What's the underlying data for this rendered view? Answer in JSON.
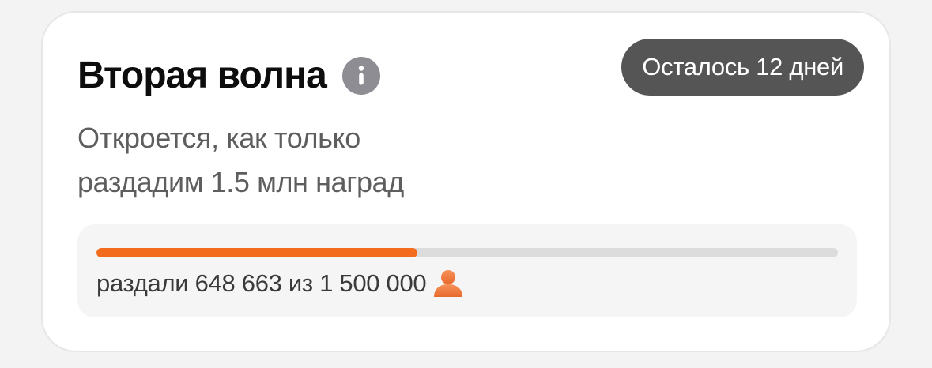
{
  "card": {
    "title": "Вторая волна",
    "badge": "Осталось 12 дней",
    "subtitle_line1": "Откроется, как только",
    "subtitle_line2": "раздадим 1.5 млн наград"
  },
  "progress": {
    "label": "раздали 648 663 из 1 500 000",
    "value": 648663,
    "max": 1500000,
    "fraction": 0.4324
  },
  "icons": {
    "info": "info-icon",
    "person": "person-icon"
  },
  "colors": {
    "accent": "#f36c1e",
    "badge_bg": "#555555",
    "info_icon": "#8d8d93",
    "track": "#dcdcdc"
  }
}
